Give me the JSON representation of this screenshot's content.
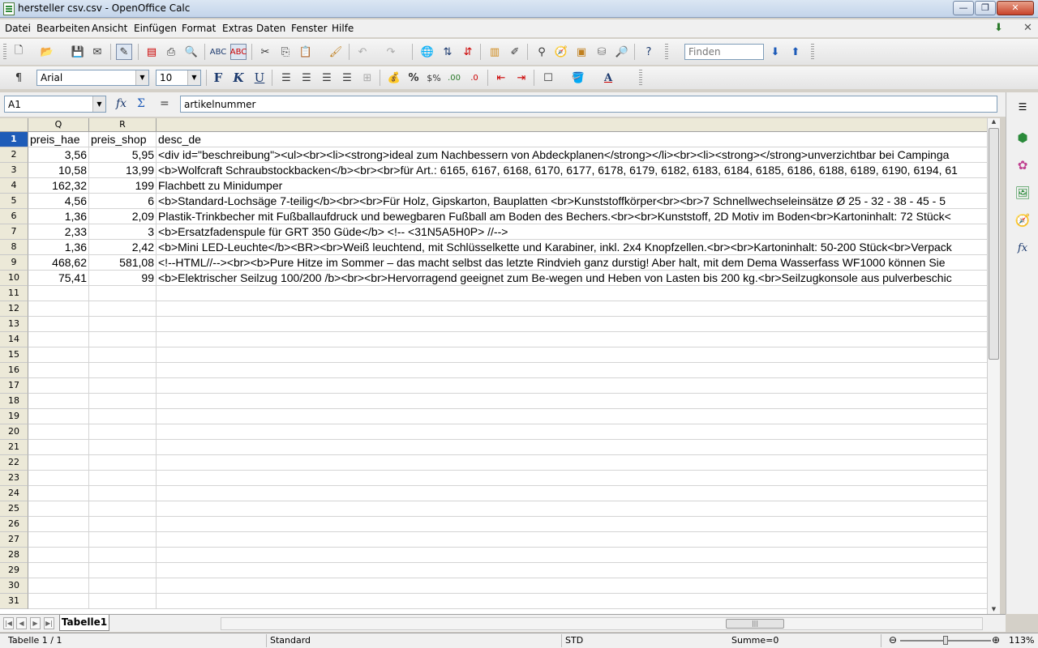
{
  "window": {
    "title": "hersteller csv.csv - OpenOffice Calc",
    "buttons": {
      "min": "—",
      "max": "❐",
      "close": "✕"
    }
  },
  "menubar": [
    "Datei",
    "Bearbeiten",
    "Ansicht",
    "Einfügen",
    "Format",
    "Extras",
    "Daten",
    "Fenster",
    "Hilfe"
  ],
  "toolbar": {
    "find_placeholder": "Finden",
    "font_name": "Arial",
    "font_size": "10",
    "bold": "F",
    "italic": "K",
    "underline": "U",
    "percent": "%"
  },
  "formula_bar": {
    "cell_ref": "A1",
    "function_wizard": "fx",
    "sum": "Σ",
    "equals": "=",
    "content": "artikelnummer"
  },
  "grid": {
    "columns": [
      "Q",
      "R"
    ],
    "rows": [
      {
        "n": "1",
        "q": "preis_hae",
        "r": "preis_shop",
        "s": "desc_de"
      },
      {
        "n": "2",
        "q": "3,56",
        "r": "5,95",
        "s": "<div id=\"beschreibung\"><ul><br><li><strong>ideal zum Nachbessern von Abdeckplanen</strong></li><br><li><strong></strong>unverzichtbar bei Campinga"
      },
      {
        "n": "3",
        "q": "10,58",
        "r": "13,99",
        "s": "<b>Wolfcraft Schraubstockbacken</b><br><br>für Art.: 6165, 6167, 6168, 6170, 6177, 6178, 6179, 6182, 6183, 6184, 6185, 6186, 6188, 6189, 6190, 6194, 61"
      },
      {
        "n": "4",
        "q": "162,32",
        "r": "199",
        "s": "Flachbett zu Minidumper"
      },
      {
        "n": "5",
        "q": "4,56",
        "r": "6",
        "s": "<b>Standard-Lochsäge 7-teilig</b><br><br>Für Holz, Gipskarton, Bauplatten <br>Kunststoffkörper<br><br>7 Schnellwechseleinsätze Ø 25 - 32 - 38 - 45 - 5"
      },
      {
        "n": "6",
        "q": "1,36",
        "r": "2,09",
        "s": "Plastik-Trinkbecher mit Fußballaufdruck und bewegbaren Fußball am Boden des Bechers.<br><br>Kunststoff, 2D Motiv im Boden<br>Kartoninhalt: 72 Stück<"
      },
      {
        "n": "7",
        "q": "2,33",
        "r": "3",
        "s": "<b>Ersatzfadenspule für GRT 350 Güde</b> <!-- <31N5A5H0P> //-->"
      },
      {
        "n": "8",
        "q": "1,36",
        "r": "2,42",
        "s": "<b>Mini LED-Leuchte</b><BR><br>Weiß leuchtend, mit Schlüsselkette und Karabiner, inkl. 2x4 Knopfzellen.<br><br>Kartoninhalt: 50-200 Stück<br>Verpack"
      },
      {
        "n": "9",
        "q": "468,62",
        "r": "581,08",
        "s": "<!--HTML//--><br><b>Pure Hitze im Sommer – das macht selbst das letzte Rindvieh ganz durstig! Aber halt, mit dem Dema Wasserfass WF1000 können Sie"
      },
      {
        "n": "10",
        "q": "75,41",
        "r": "99",
        "s": "<b>Elektrischer Seilzug 100/200 /b><br><br>Hervorragend geeignet zum Be-wegen und Heben von Lasten bis 200 kg.<br>Seilzugkonsole aus pulverbeschic"
      }
    ],
    "empty_rows": [
      "11",
      "12",
      "13",
      "14",
      "15",
      "16",
      "17",
      "18",
      "19",
      "20",
      "21",
      "22",
      "23",
      "24",
      "25",
      "26",
      "27",
      "28",
      "29",
      "30",
      "31"
    ]
  },
  "sheet_tabs": {
    "active": "Tabelle1"
  },
  "statusbar": {
    "sheet": "Tabelle 1 / 1",
    "style": "Standard",
    "mode": "STD",
    "sum": "Summe=0",
    "zoom": "113%"
  },
  "colors": {
    "row_selected": "#1e5cb8",
    "header_bg": "#ece9d8"
  }
}
